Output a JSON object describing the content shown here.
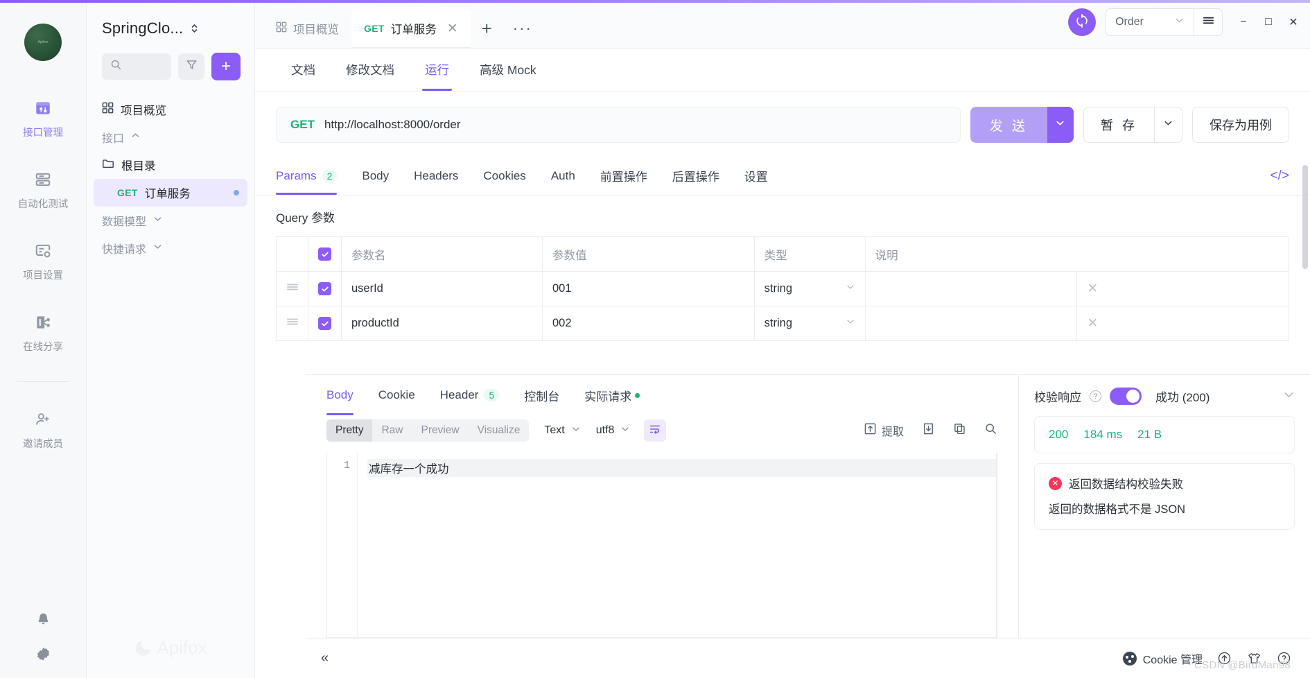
{
  "window": {
    "sync_icon": "sync-icon",
    "environment": "Order",
    "menu_icon": "hamburger-icon",
    "minimize": "−",
    "maximize": "□",
    "close": "✕"
  },
  "rail": {
    "items": [
      {
        "label": "接口管理",
        "icon": "api-manage-icon",
        "active": true
      },
      {
        "label": "自动化测试",
        "icon": "automation-test-icon",
        "active": false
      },
      {
        "label": "项目设置",
        "icon": "project-settings-icon",
        "active": false
      },
      {
        "label": "在线分享",
        "icon": "online-share-icon",
        "active": false
      },
      {
        "label": "邀请成员",
        "icon": "invite-member-icon",
        "active": false
      }
    ],
    "bottom": [
      {
        "label": "通知",
        "icon": "bell-icon"
      },
      {
        "label": "设置",
        "icon": "gear-icon"
      }
    ]
  },
  "sidebar": {
    "project_name": "SpringClo...",
    "switch_icon": "up-down-chevron-icon",
    "search_placeholder": "",
    "search_icon": "search-icon",
    "filter_icon": "filter-icon",
    "add_label": "+",
    "watermark": "Apifox",
    "tree": [
      {
        "label": "项目概览",
        "icon": "overview-icon",
        "kind": "overview"
      },
      {
        "label": "接口",
        "icon": "chevron-up-icon",
        "kind": "group"
      },
      {
        "label": "根目录",
        "icon": "folder-icon",
        "kind": "folder"
      },
      {
        "label": "订单服务",
        "method": "GET",
        "kind": "api",
        "selected": true
      },
      {
        "label": "数据模型",
        "icon": "chevron-down-icon",
        "kind": "group"
      },
      {
        "label": "快捷请求",
        "icon": "chevron-down-icon",
        "kind": "group"
      }
    ]
  },
  "tabs": {
    "items": [
      {
        "label": "项目概览",
        "icon": "overview-icon",
        "active": false
      },
      {
        "label": "订单服务",
        "method": "GET",
        "active": true,
        "close": "✕"
      }
    ],
    "add": "+",
    "more": "···"
  },
  "subtabs": [
    {
      "label": "文档",
      "active": false
    },
    {
      "label": "修改文档",
      "active": false
    },
    {
      "label": "运行",
      "active": true
    },
    {
      "label": "高级 Mock",
      "active": false
    }
  ],
  "request": {
    "method": "GET",
    "url": "http://localhost:8000/order",
    "send_label": "发 送",
    "send_caret_icon": "chevron-down-icon",
    "save_label": "暂 存",
    "save_caret_icon": "chevron-down-icon",
    "save_case_label": "保存为用例",
    "tabs": [
      {
        "label": "Params",
        "count": "2",
        "active": true
      },
      {
        "label": "Body",
        "active": false
      },
      {
        "label": "Headers",
        "active": false
      },
      {
        "label": "Cookies",
        "active": false
      },
      {
        "label": "Auth",
        "active": false
      },
      {
        "label": "前置操作",
        "active": false
      },
      {
        "label": "后置操作",
        "active": false
      },
      {
        "label": "设置",
        "active": false
      }
    ],
    "code_icon": "</>",
    "params": {
      "title": "Query 参数",
      "headers": [
        "",
        "",
        "参数名",
        "参数值",
        "类型",
        "说明"
      ],
      "rows": [
        {
          "checked": true,
          "name": "userId",
          "value": "001",
          "type": "string",
          "desc": ""
        },
        {
          "checked": true,
          "name": "productId",
          "value": "002",
          "type": "string",
          "desc": ""
        }
      ]
    }
  },
  "response": {
    "tabs": [
      {
        "label": "Body",
        "active": true
      },
      {
        "label": "Cookie",
        "active": false
      },
      {
        "label": "Header",
        "count": "5",
        "active": false
      },
      {
        "label": "控制台",
        "active": false
      },
      {
        "label": "实际请求",
        "dot": true,
        "active": false
      }
    ],
    "format_modes": [
      {
        "label": "Pretty",
        "on": true
      },
      {
        "label": "Raw",
        "on": false
      },
      {
        "label": "Preview",
        "on": false
      },
      {
        "label": "Visualize",
        "on": false
      }
    ],
    "type_select": "Text",
    "charset_select": "utf8",
    "wrap_icon": "word-wrap-icon",
    "actions": [
      {
        "label": "提取",
        "icon": "extract-icon"
      },
      {
        "label": "",
        "icon": "download-icon"
      },
      {
        "label": "",
        "icon": "copy-icon"
      },
      {
        "label": "",
        "icon": "search-icon"
      }
    ],
    "body_lines": [
      {
        "no": "1",
        "text": "减库存一个成功"
      }
    ],
    "verify": {
      "label": "校验响应",
      "help_icon": "question-icon",
      "toggle_on": true,
      "status_label": "成功 (200)",
      "chevron_icon": "chevron-down-icon"
    },
    "stats": {
      "status": "200",
      "time": "184 ms",
      "size": "21 B"
    },
    "error": {
      "title": "返回数据结构校验失败",
      "detail": "返回的数据格式不是 JSON",
      "icon": "error-x-icon"
    }
  },
  "footer": {
    "collapse_icon": "«",
    "cookie_label": "Cookie 管理",
    "icons": [
      "upload-circle-icon",
      "shirt-icon",
      "help-circle-icon"
    ],
    "watermark": "CSDN @BirdMan98"
  }
}
